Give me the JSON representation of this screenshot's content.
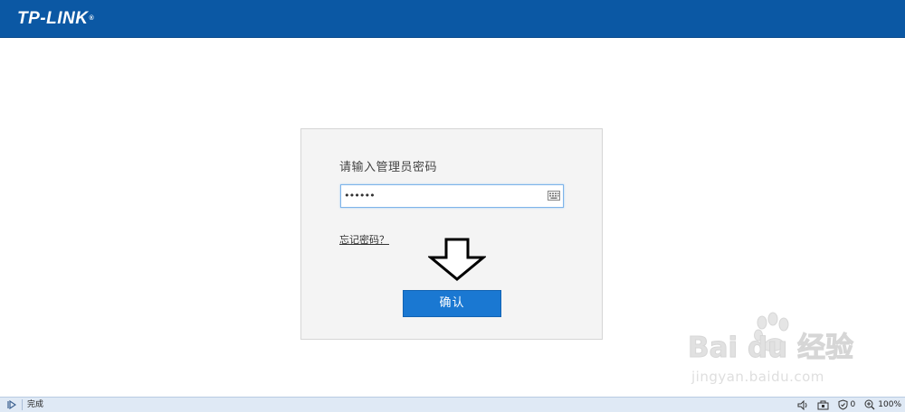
{
  "header": {
    "logo_text": "TP-LINK",
    "logo_mark": "®",
    "background_color": "#0b58a4"
  },
  "login": {
    "prompt": "请输入管理员密码",
    "password_value": "••••••",
    "keyboard_icon": "keyboard-icon",
    "forgot_link": "忘记密码？",
    "confirm_label": "确认",
    "annotation_icon": "down-arrow-icon",
    "button_color": "#1a78d2"
  },
  "watermark": {
    "brand": "Bai du 经验",
    "site": "jingyan.baidu.com"
  },
  "statusbar": {
    "status_text": "完成",
    "shield_count": "0",
    "zoom_level": "100%",
    "icons": [
      "play-icon",
      "speaker-icon",
      "network-icon",
      "shield-icon",
      "zoom-icon"
    ]
  }
}
